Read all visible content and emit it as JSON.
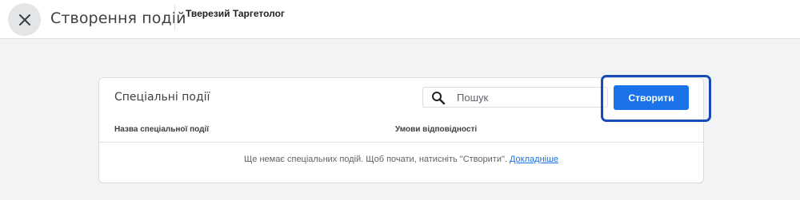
{
  "header": {
    "close_icon": "close-icon",
    "title": "Створення подій",
    "account_name": "Тверезий Таргетолог"
  },
  "card": {
    "title": "Спеціальні події",
    "search": {
      "placeholder": "Пошук",
      "icon": "search-icon"
    },
    "columns": [
      "Назва спеціальної події",
      "Умови відповідності"
    ],
    "empty_message": "Ще немає спеціальних подій. Щоб почати, натисніть \"Створити\".",
    "learn_more": "Докладніше"
  },
  "create_button": {
    "label": "Створити"
  },
  "colors": {
    "accent": "#1a73e8",
    "highlight_border": "#1a4ab8",
    "background": "#f1f3f4"
  }
}
